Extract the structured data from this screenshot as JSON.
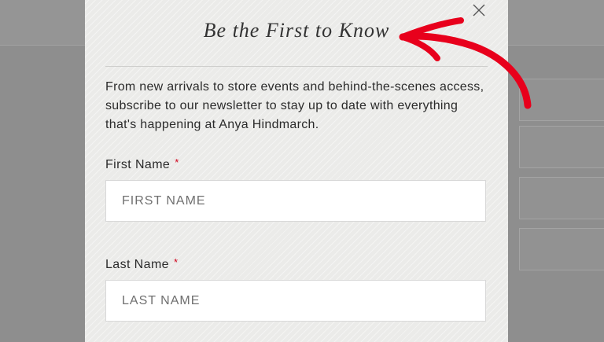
{
  "modal": {
    "title": "Be the First to Know",
    "description": "From new arrivals to store events and behind-the-scenes access, subscribe to our newsletter to stay up to date with everything that's happening at Anya Hindmarch.",
    "close_icon": "close-icon",
    "required_marker": "*"
  },
  "form": {
    "first_name": {
      "label": "First Name",
      "placeholder": "FIRST NAME",
      "value": ""
    },
    "last_name": {
      "label": "Last Name",
      "placeholder": "LAST NAME",
      "value": ""
    }
  },
  "annotation": {
    "arrow_icon": "arrow-icon",
    "color": "#e8001c"
  },
  "colors": {
    "overlay": "#8e8e8e",
    "modal_bg": "#ebebe9",
    "required": "#d0021b"
  }
}
